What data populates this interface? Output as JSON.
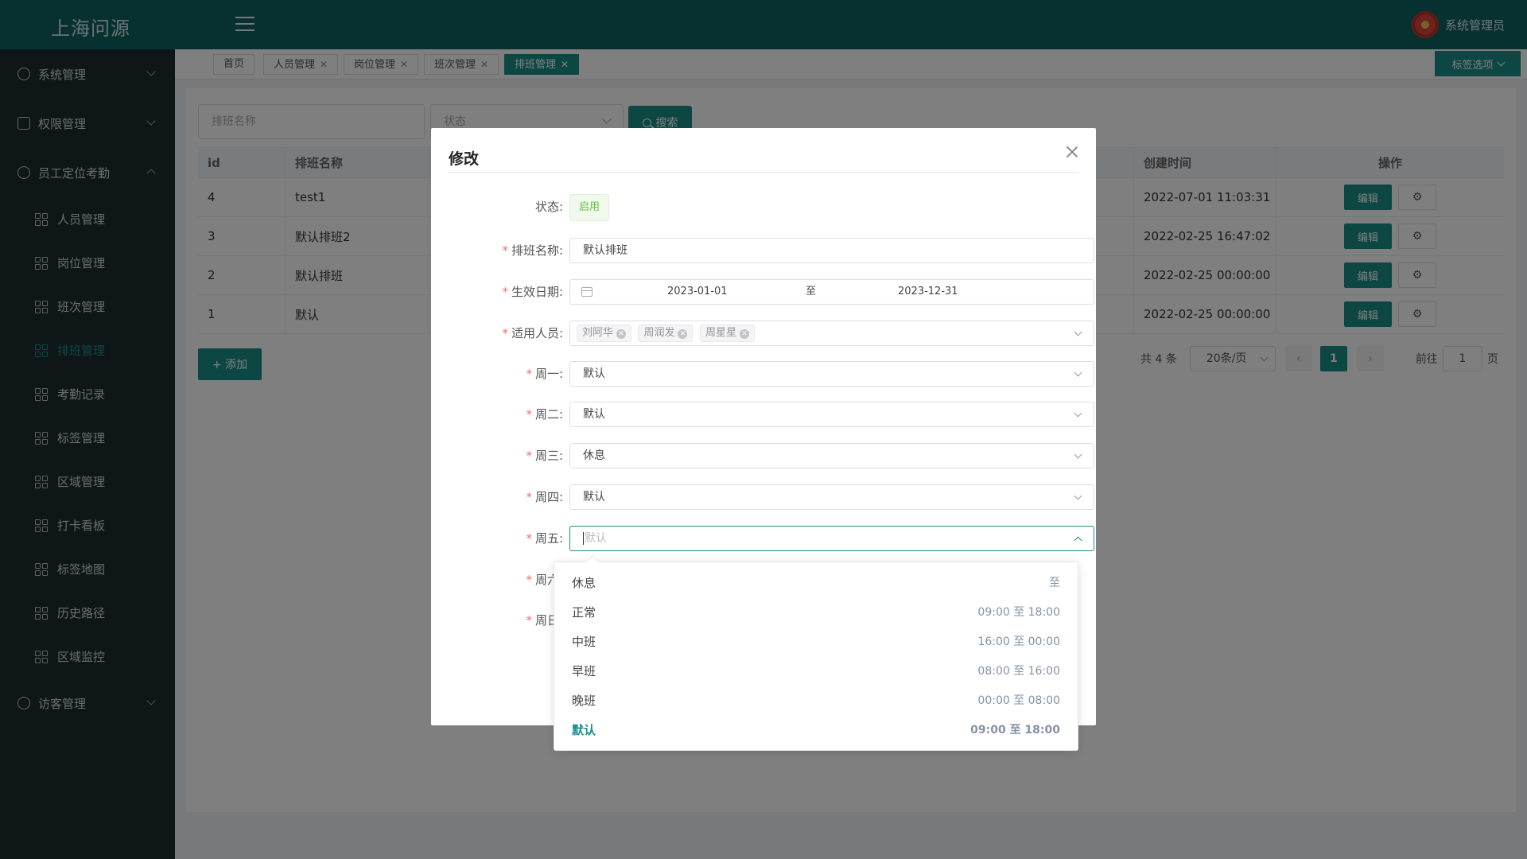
{
  "header": {
    "logo": "上海问源",
    "user_name": "系统管理员"
  },
  "sidebar": {
    "groups_top": [
      {
        "label": "系统管理"
      },
      {
        "label": "权限管理"
      },
      {
        "label": "员工定位考勤"
      }
    ],
    "sub_items": [
      {
        "label": "人员管理"
      },
      {
        "label": "岗位管理"
      },
      {
        "label": "班次管理"
      },
      {
        "label": "排班管理"
      },
      {
        "label": "考勤记录"
      },
      {
        "label": "标签管理"
      },
      {
        "label": "区域管理"
      },
      {
        "label": "打卡看板"
      },
      {
        "label": "标签地图"
      },
      {
        "label": "历史路径"
      },
      {
        "label": "区域监控"
      }
    ],
    "active_item": "排班管理",
    "group_bottom": {
      "label": "访客管理"
    }
  },
  "tabs": [
    {
      "label": "首页",
      "closable": false
    },
    {
      "label": "人员管理",
      "closable": true
    },
    {
      "label": "岗位管理",
      "closable": true
    },
    {
      "label": "班次管理",
      "closable": true
    },
    {
      "label": "排班管理",
      "closable": true,
      "active": true
    }
  ],
  "tag_options_label": "标签选项",
  "filters": {
    "name_placeholder": "排班名称",
    "status_placeholder": "状态",
    "search_label": "搜索"
  },
  "table": {
    "headers": {
      "id": "id",
      "name": "排班名称",
      "created": "创建时间",
      "ops": "操作"
    },
    "rows": [
      {
        "id": "4",
        "name": "test1",
        "created": "2022-07-01 11:03:31"
      },
      {
        "id": "3",
        "name": "默认排班2",
        "created": "2022-02-25 16:47:02"
      },
      {
        "id": "2",
        "name": "默认排班",
        "created": "2022-02-25 00:00:00"
      },
      {
        "id": "1",
        "name": "默认",
        "created": "2022-02-25 00:00:00"
      }
    ],
    "edit_label": "编辑"
  },
  "add_label": "+ 添加",
  "pagination": {
    "total": "共 4 条",
    "page_size": "20条/页",
    "current": "1",
    "goto_label": "前往",
    "goto_value": "1",
    "page_unit": "页"
  },
  "modal": {
    "title": "修改",
    "status_label": "状态:",
    "status_value": "启用",
    "name_label": "排班名称:",
    "name_value": "默认排班",
    "date_label": "生效日期:",
    "date_start": "2023-01-01",
    "date_to": "至",
    "date_end": "2023-12-31",
    "staff_label": "适用人员:",
    "staff": [
      "刘阿华",
      "周润发",
      "周星星"
    ],
    "days": [
      {
        "label": "周一:",
        "value": "默认"
      },
      {
        "label": "周二:",
        "value": "默认"
      },
      {
        "label": "周三:",
        "value": "休息"
      },
      {
        "label": "周四:",
        "value": "默认"
      },
      {
        "label": "周五:",
        "value": "默认"
      },
      {
        "label": "周六:",
        "value": ""
      },
      {
        "label": "周日:",
        "value": ""
      }
    ]
  },
  "dropdown": {
    "options": [
      {
        "name": "休息",
        "time": "至"
      },
      {
        "name": "正常",
        "time": "09:00 至 18:00"
      },
      {
        "name": "中班",
        "time": "16:00 至 00:00"
      },
      {
        "name": "早班",
        "time": "08:00 至 16:00"
      },
      {
        "name": "晚班",
        "time": "00:00 至 08:00"
      },
      {
        "name": "默认",
        "time": "09:00 至 18:00",
        "selected": true
      }
    ]
  },
  "colors": {
    "primary": "#1b8f89",
    "header": "#0f6360",
    "sidebar": "#1f2d2e",
    "required": "#f56c6c",
    "success": "#67c23a"
  }
}
